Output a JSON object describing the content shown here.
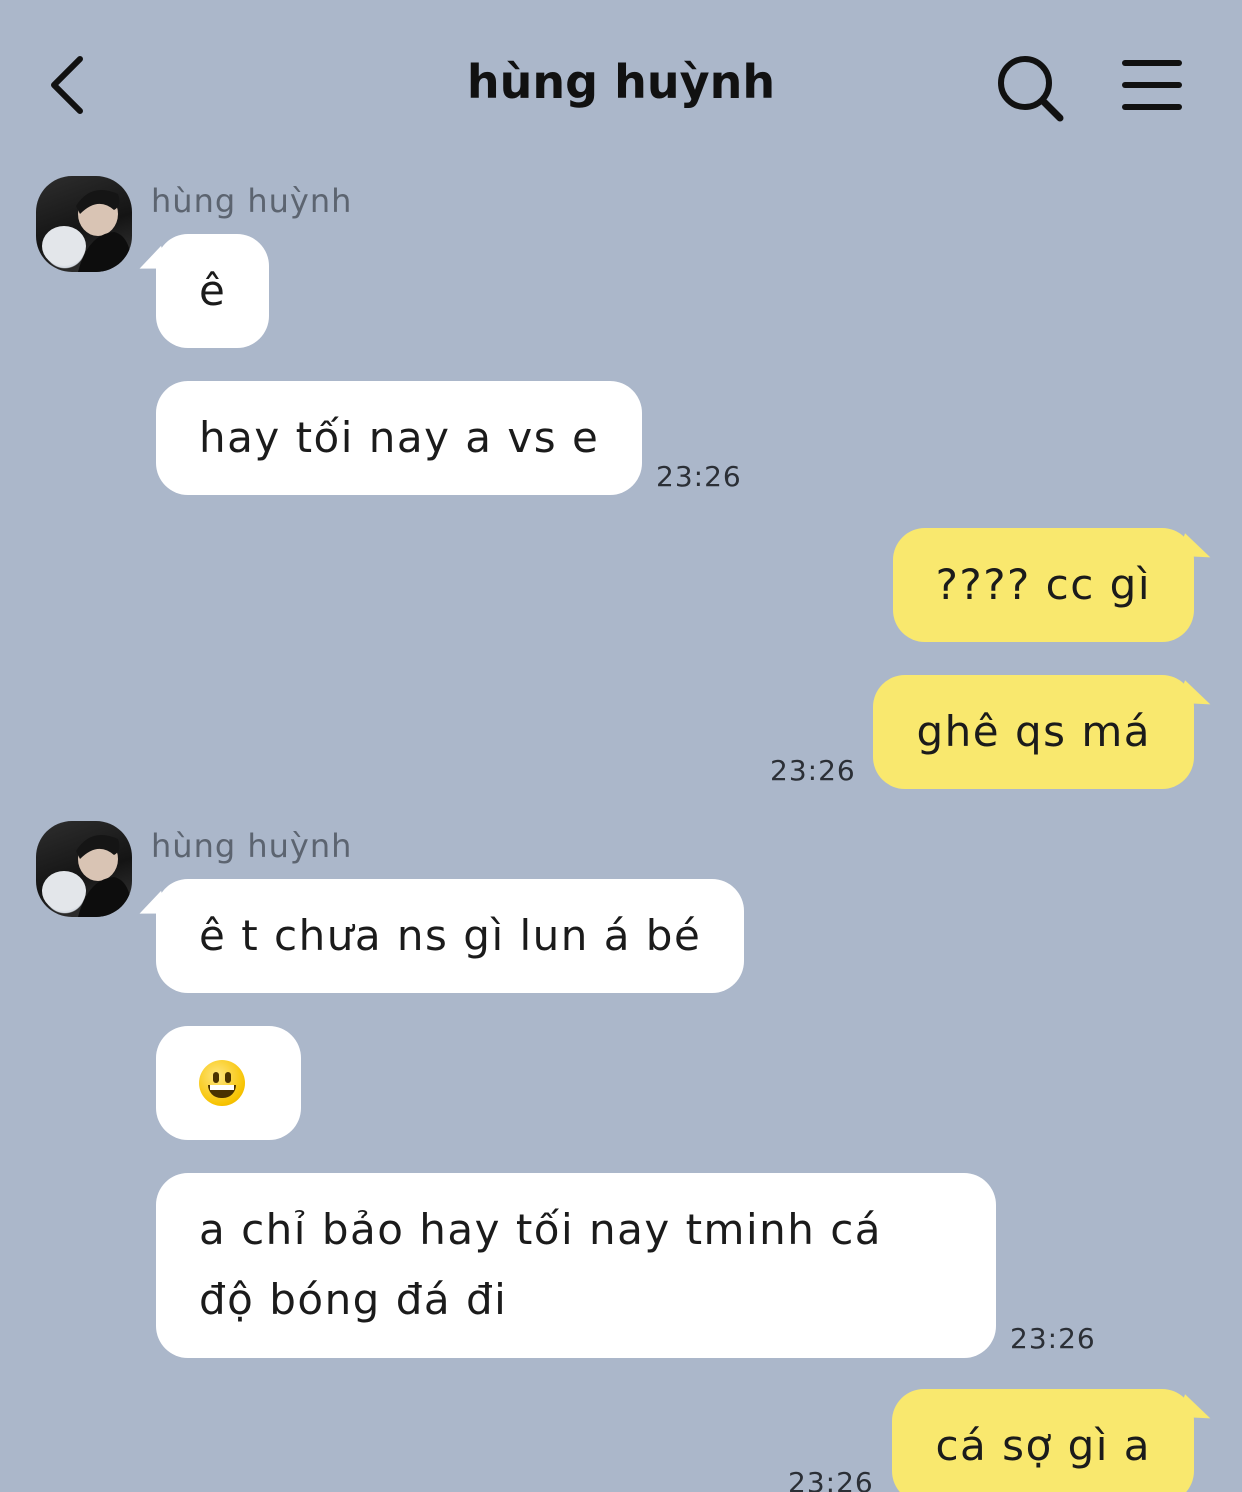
{
  "header": {
    "title": "hùng huỳnh",
    "back_icon": "chevron-left-icon",
    "search_icon": "search-icon",
    "menu_icon": "hamburger-menu-icon"
  },
  "colors": {
    "background": "#abb7ca",
    "incoming_bubble": "#ffffff",
    "outgoing_bubble": "#f9e86e"
  },
  "messages": [
    {
      "sender": "hùng huỳnh",
      "text": "ê",
      "direction": "incoming"
    },
    {
      "text": "hay tối nay a vs e",
      "direction": "incoming",
      "time": "23:26"
    },
    {
      "text": "???? cc gì",
      "direction": "outgoing"
    },
    {
      "text": "ghê qs má",
      "direction": "outgoing",
      "time": "23:26"
    },
    {
      "sender": "hùng huỳnh",
      "text": "ê t chưa ns gì lun á bé",
      "direction": "incoming"
    },
    {
      "text": "grinning-face-emoji",
      "direction": "incoming"
    },
    {
      "text_line1": "a chỉ bảo hay tối nay tminh cá",
      "text_line2": "độ bóng đá đi",
      "direction": "incoming",
      "time": "23:26"
    },
    {
      "text": "cá sợ gì a",
      "direction": "outgoing",
      "time": "23:26"
    }
  ]
}
